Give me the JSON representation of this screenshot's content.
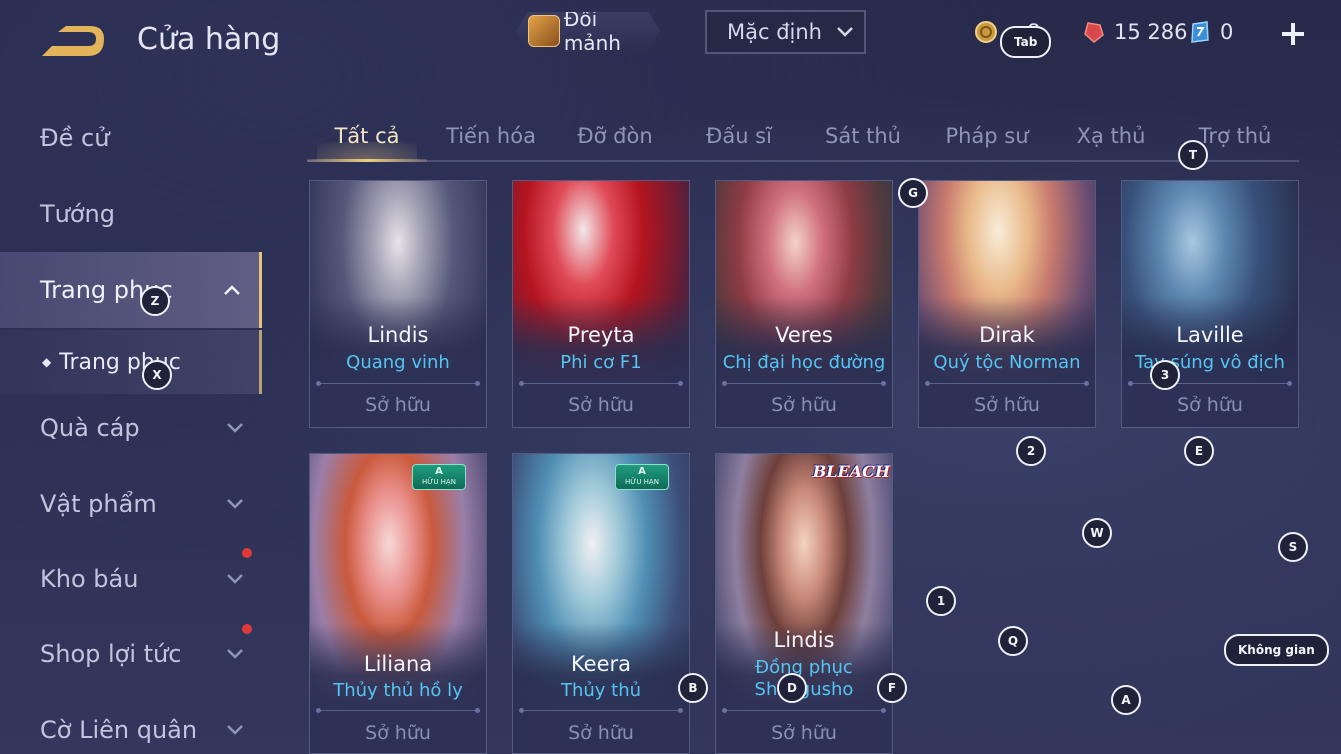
{
  "header": {
    "title": "Cửa hàng",
    "exchange_label": "Đổi mảnh",
    "sort_value": "Mặc định",
    "currency_gold": "…8",
    "currency_rubies": "15 286",
    "currency_vouchers": "0"
  },
  "sidebar": {
    "items": [
      {
        "label": "Đề cử"
      },
      {
        "label": "Tướng"
      },
      {
        "label": "Trang phục"
      },
      {
        "label": "Quà cáp"
      },
      {
        "label": "Vật phẩm"
      },
      {
        "label": "Kho báu"
      },
      {
        "label": "Shop lợi tức"
      },
      {
        "label": "Cờ Liên quân"
      }
    ],
    "sub_item": "Trang phục"
  },
  "tabs": [
    "Tất cả",
    "Tiến hóa",
    "Đỡ đòn",
    "Đấu sĩ",
    "Sát thủ",
    "Pháp sư",
    "Xạ thủ",
    "Trợ thủ"
  ],
  "cards": [
    {
      "hero": "Lindis",
      "skin": "Quang vinh",
      "status": "Sở hữu"
    },
    {
      "hero": "Preyta",
      "skin": "Phi cơ F1",
      "status": "Sở hữu"
    },
    {
      "hero": "Veres",
      "skin": "Chị đại học đường",
      "status": "Sở hữu"
    },
    {
      "hero": "Dirak",
      "skin": "Quý tộc Norman",
      "status": "Sở hữu"
    },
    {
      "hero": "Laville",
      "skin": "Tay súng vô địch",
      "status": "Sở hữu"
    },
    {
      "hero": "Liliana",
      "skin": "Thủy thủ hồ ly",
      "status": "Sở hữu",
      "badge": "HỮU HẠN"
    },
    {
      "hero": "Keera",
      "skin": "Thủy thủ",
      "status": "Sở hữu",
      "badge": "HỮU HẠN"
    },
    {
      "hero": "Lindis",
      "skin": "Đồng phục",
      "skin2": "Shinigusho",
      "status": "Sở hữu",
      "badge": "BLEACH"
    }
  ],
  "badges": {
    "limited_letter": "A"
  },
  "key_hints": {
    "tab": "Tab",
    "z": "Z",
    "x": "X",
    "t": "T",
    "g": "G",
    "k3": "3",
    "k2": "2",
    "e": "E",
    "w": "W",
    "s": "S",
    "k1": "1",
    "q": "Q",
    "space": "Không gian",
    "b": "B",
    "d": "D",
    "f": "F",
    "a": "A"
  },
  "colors": {
    "accent_gold": "#f0cd83",
    "skin_name": "#54c4f0",
    "notify_red": "#e0393a"
  }
}
